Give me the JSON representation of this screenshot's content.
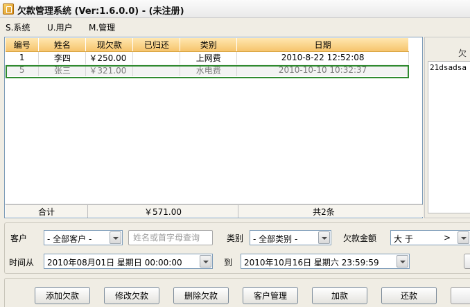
{
  "window": {
    "title": "欠款管理系统 (Ver:1.6.0.0) - (未注册)"
  },
  "menu": [
    {
      "label": "S.系统"
    },
    {
      "label": "U.用户"
    },
    {
      "label": "M.管理"
    }
  ],
  "table": {
    "columns": [
      "编号",
      "姓名",
      "现欠款",
      "已归还",
      "类别",
      "日期"
    ],
    "rows": [
      {
        "id": "1",
        "name": "李四",
        "owed": "￥250.00",
        "returned": "",
        "category": "上网费",
        "date": "2010-8-22 12:52:08"
      },
      {
        "id": "5",
        "name": "张三",
        "owed": "￥321.00",
        "returned": "",
        "category": "水电费",
        "date": "2010-10-10 10:32:37"
      }
    ],
    "summary": {
      "label": "合计",
      "total": "￥571.00",
      "count": "共2条"
    }
  },
  "side_panel": {
    "caption": "欠",
    "text": "21dsadsa"
  },
  "filters": {
    "customer_label": "客户",
    "customer_value": "- 全部客户 -",
    "search_placeholder": "姓名或首字母查询",
    "category_label": "类别",
    "category_value": "- 全部类别 -",
    "amount_label": "欠款金额",
    "amount_op": "大  于",
    "amount_op_arrow": ">",
    "time_from_label": "时间从",
    "time_from_value": "2010年08月01日  星期日  00:00:00",
    "to_label": "到",
    "time_to_value": "2010年10月16日  星期六  23:59:59"
  },
  "buttons": [
    {
      "label": "添加欠款"
    },
    {
      "label": "修改欠款"
    },
    {
      "label": "删除欠款"
    },
    {
      "label": "客户管理"
    },
    {
      "label": "加款"
    },
    {
      "label": "还款"
    }
  ],
  "colors": {
    "header_gradient_top": "#ffe7b0",
    "header_gradient_bottom": "#f6c46c",
    "selection_border": "#2f8a2f"
  }
}
